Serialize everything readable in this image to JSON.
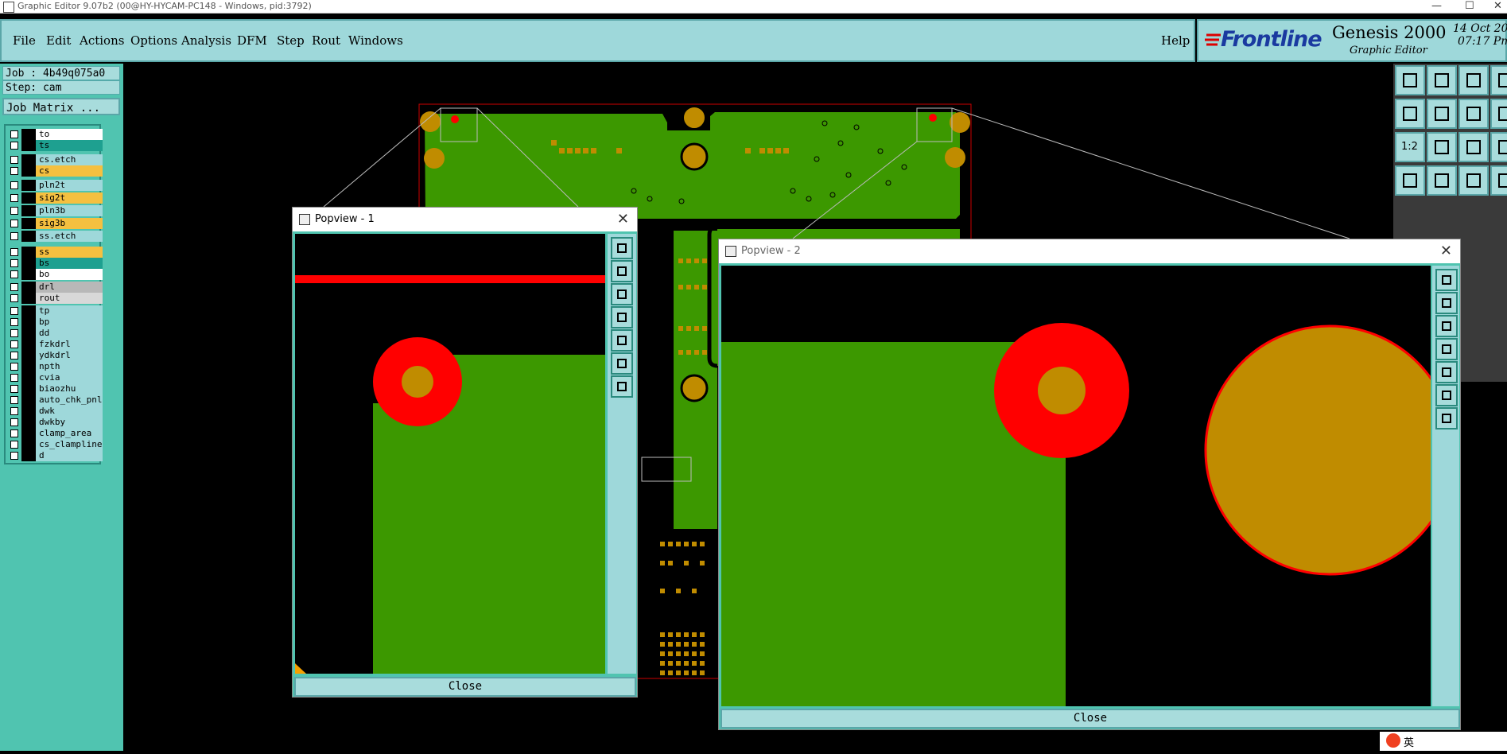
{
  "window": {
    "title": "Graphic Editor 9.07b2 (00@HY-HYCAM-PC148 - Windows, pid:3792)"
  },
  "menu": [
    "File",
    "Edit",
    "Actions",
    "Options",
    "Analysis",
    "DFM",
    "Step",
    "Rout",
    "Windows"
  ],
  "help_label": "Help",
  "brand": {
    "logo": "Frontline",
    "product": "Genesis 2000",
    "subtitle": "Graphic Editor",
    "date": "14 Oct 20",
    "time": "07:17 Pm"
  },
  "job": {
    "job_label": "Job : 4b49q075a0",
    "step_label": "Step: cam",
    "matrix_button": "Job Matrix ..."
  },
  "layers": [
    {
      "name": "to",
      "color": "#ffffff"
    },
    {
      "name": "ts",
      "color": "#1ea090"
    },
    {
      "name": "cs.etch",
      "color": "#9ed8da"
    },
    {
      "name": "cs",
      "color": "#f5c040"
    },
    {
      "name": "pln2t",
      "color": "#9ed8da"
    },
    {
      "name": "sig2t",
      "color": "#f5c040"
    },
    {
      "name": "pln3b",
      "color": "#9ed8da"
    },
    {
      "name": "sig3b",
      "color": "#f5c040"
    },
    {
      "name": "ss.etch",
      "color": "#9ed8da"
    },
    {
      "name": "ss",
      "color": "#f5c040"
    },
    {
      "name": "bs",
      "color": "#1ea090"
    },
    {
      "name": "bo",
      "color": "#ffffff"
    },
    {
      "name": "drl",
      "color": "#b8b8b8"
    },
    {
      "name": "rout",
      "color": "#d8d8d8"
    },
    {
      "name": "tp",
      "color": "#9ed8da"
    },
    {
      "name": "bp",
      "color": "#9ed8da"
    },
    {
      "name": "dd",
      "color": "#9ed8da"
    },
    {
      "name": "fzkdrl",
      "color": "#9ed8da"
    },
    {
      "name": "ydkdrl",
      "color": "#9ed8da"
    },
    {
      "name": "npth",
      "color": "#9ed8da"
    },
    {
      "name": "cvia",
      "color": "#9ed8da"
    },
    {
      "name": "biaozhu",
      "color": "#9ed8da"
    },
    {
      "name": "auto_chk_pnl",
      "color": "#9ed8da"
    },
    {
      "name": "dwk",
      "color": "#9ed8da"
    },
    {
      "name": "dwkby",
      "color": "#9ed8da"
    },
    {
      "name": "clamp_area",
      "color": "#9ed8da"
    },
    {
      "name": "cs_clampline",
      "color": "#9ed8da"
    },
    {
      "name": "d",
      "color": "#9ed8da"
    }
  ],
  "toolbar_ratio_label": "1:2",
  "popview1": {
    "title": "Popview - 1",
    "close_label": "Close"
  },
  "popview2": {
    "title": "Popview - 2",
    "close_label": "Close"
  },
  "tray": {
    "ime": "英"
  },
  "colors": {
    "board_green": "#3c9800",
    "pad_gold": "#c08c00",
    "pad_red": "#ff0000",
    "panel_teal": "#50c4b0",
    "menu_bg": "#9ed8da"
  }
}
